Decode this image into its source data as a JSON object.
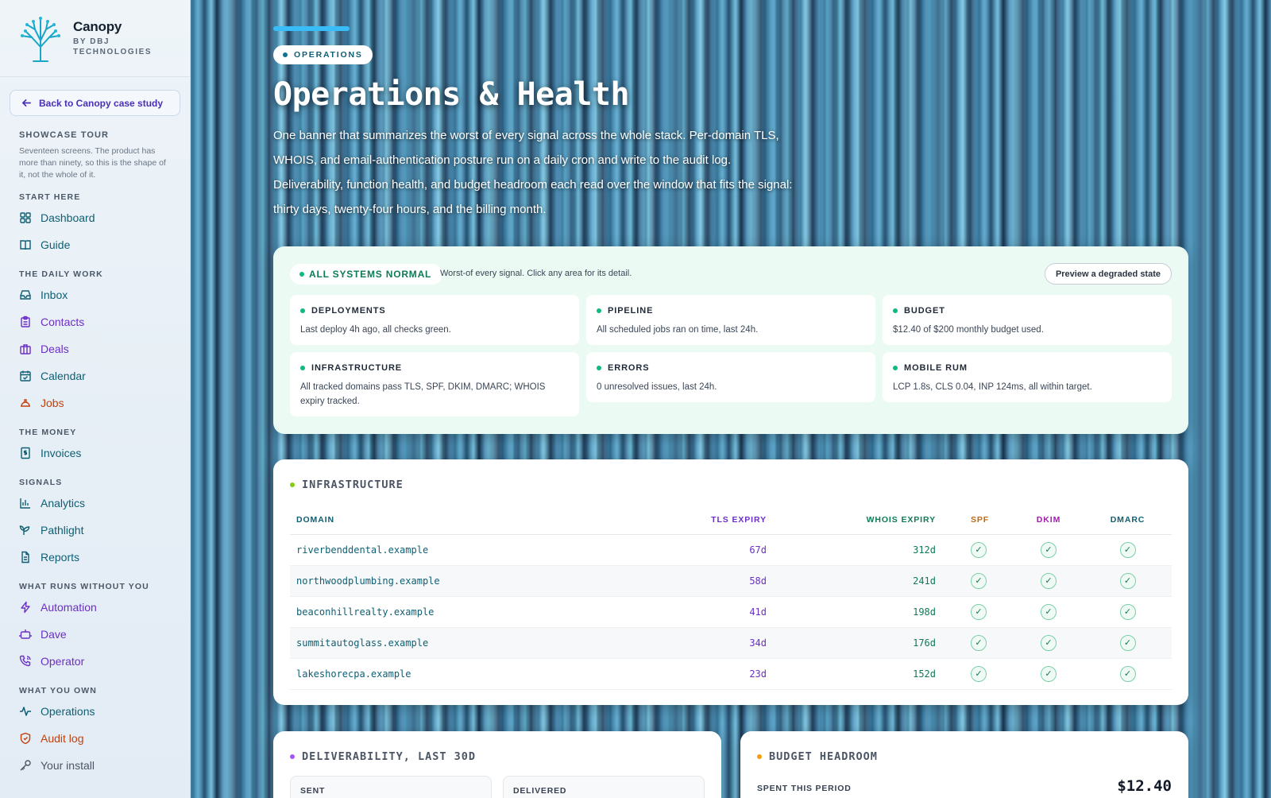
{
  "brand": {
    "name": "Canopy",
    "sub1": "BY DBJ",
    "sub2": "TECHNOLOGIES"
  },
  "back_link": "Back to Canopy case study",
  "tour": {
    "heading": "SHOWCASE TOUR",
    "desc": "Seventeen screens. The product has more than ninety, so this is the shape of it, not the whole of it."
  },
  "nav": {
    "start": "START HERE",
    "dashboard": "Dashboard",
    "guide": "Guide",
    "daily": "THE DAILY WORK",
    "inbox": "Inbox",
    "contacts": "Contacts",
    "deals": "Deals",
    "calendar": "Calendar",
    "jobs": "Jobs",
    "money": "THE MONEY",
    "invoices": "Invoices",
    "signals": "SIGNALS",
    "analytics": "Analytics",
    "pathlight": "Pathlight",
    "reports": "Reports",
    "runs": "WHAT RUNS WITHOUT YOU",
    "automation": "Automation",
    "dave": "Dave",
    "operator": "Operator",
    "own": "WHAT YOU OWN",
    "operations": "Operations",
    "audit": "Audit log",
    "install": "Your install"
  },
  "hero": {
    "pill": "OPERATIONS",
    "title": "Operations & Health",
    "desc": "One banner that summarizes the worst of every signal across the whole stack. Per-domain TLS, WHOIS, and email-authentication posture run on a daily cron and write to the audit log. Deliverability, function health, and budget headroom each read over the window that fits the signal: thirty days, twenty-four hours, and the billing month."
  },
  "status": {
    "pill": "ALL SYSTEMS NORMAL",
    "note": "Worst-of every signal. Click any area for its detail.",
    "preview_btn": "Preview a degraded state",
    "tiles": [
      {
        "title": "DEPLOYMENTS",
        "text": "Last deploy 4h ago, all checks green."
      },
      {
        "title": "PIPELINE",
        "text": "All scheduled jobs ran on time, last 24h."
      },
      {
        "title": "BUDGET",
        "text": "$12.40 of $200 monthly budget used."
      },
      {
        "title": "INFRASTRUCTURE",
        "text": "All tracked domains pass TLS, SPF, DKIM, DMARC; WHOIS expiry tracked."
      },
      {
        "title": "ERRORS",
        "text": "0 unresolved issues, last 24h."
      },
      {
        "title": "MOBILE RUM",
        "text": "LCP 1.8s, CLS 0.04, INP 124ms, all within target."
      }
    ]
  },
  "infra": {
    "title": "INFRASTRUCTURE",
    "columns": {
      "domain": "DOMAIN",
      "tls": "TLS EXPIRY",
      "whois": "WHOIS EXPIRY",
      "spf": "SPF",
      "dkim": "DKIM",
      "dmarc": "DMARC"
    },
    "rows": [
      {
        "domain": "riverbenddental.example",
        "tls": "67d",
        "whois": "312d"
      },
      {
        "domain": "northwoodplumbing.example",
        "tls": "58d",
        "whois": "241d"
      },
      {
        "domain": "beaconhillrealty.example",
        "tls": "41d",
        "whois": "198d"
      },
      {
        "domain": "summitautoglass.example",
        "tls": "34d",
        "whois": "176d"
      },
      {
        "domain": "lakeshorecpa.example",
        "tls": "23d",
        "whois": "152d"
      }
    ],
    "check": "✓"
  },
  "deliverability": {
    "title": "DELIVERABILITY, LAST 30D",
    "sent": "SENT",
    "delivered": "DELIVERED"
  },
  "budget": {
    "title": "BUDGET HEADROOM",
    "spent_label": "SPENT THIS PERIOD",
    "spent_value": "$12.40"
  },
  "colors": {
    "accent": "#38bdf8",
    "ok": "#10b981",
    "brand_purple": "#6b2fc7",
    "brand_teal": "#0e5f73"
  }
}
